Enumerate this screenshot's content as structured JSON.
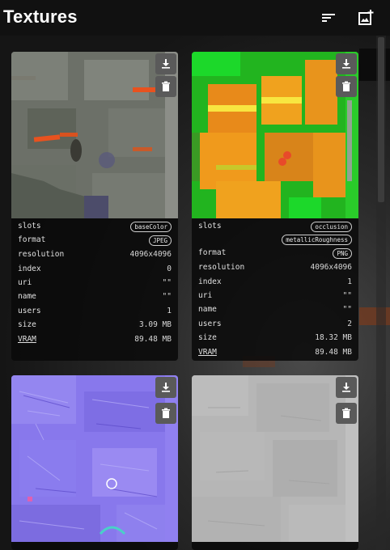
{
  "header": {
    "title": "Textures",
    "sort_icon": "sort-lines-icon",
    "add_icon": "add-image-icon"
  },
  "labels": {
    "slots": "slots",
    "format": "format",
    "resolution": "resolution",
    "index": "index",
    "uri": "uri",
    "name": "name",
    "users": "users",
    "size": "size",
    "vram": "VRAM"
  },
  "textures": [
    {
      "slots": [
        "baseColor"
      ],
      "format": "JPEG",
      "resolution": "4096x4096",
      "index": "0",
      "uri": "\"\"",
      "name": "\"\"",
      "users": "1",
      "size": "3.09 MB",
      "vram": "89.48 MB",
      "theme": "grey-orange"
    },
    {
      "slots": [
        "occlusion",
        "metallicRoughness"
      ],
      "format": "PNG",
      "resolution": "4096x4096",
      "index": "1",
      "uri": "\"\"",
      "name": "\"\"",
      "users": "2",
      "size": "18.32 MB",
      "vram": "89.48 MB",
      "theme": "green-orange"
    },
    {
      "theme": "normal-map"
    },
    {
      "theme": "light-grey"
    }
  ],
  "colors": {
    "background": "#141414",
    "card": "#0a0a0a",
    "button": "#5a5a5a",
    "accent_orange": "#e8521f",
    "normal_purple": "#8a78f0",
    "green": "#1fd22a"
  }
}
